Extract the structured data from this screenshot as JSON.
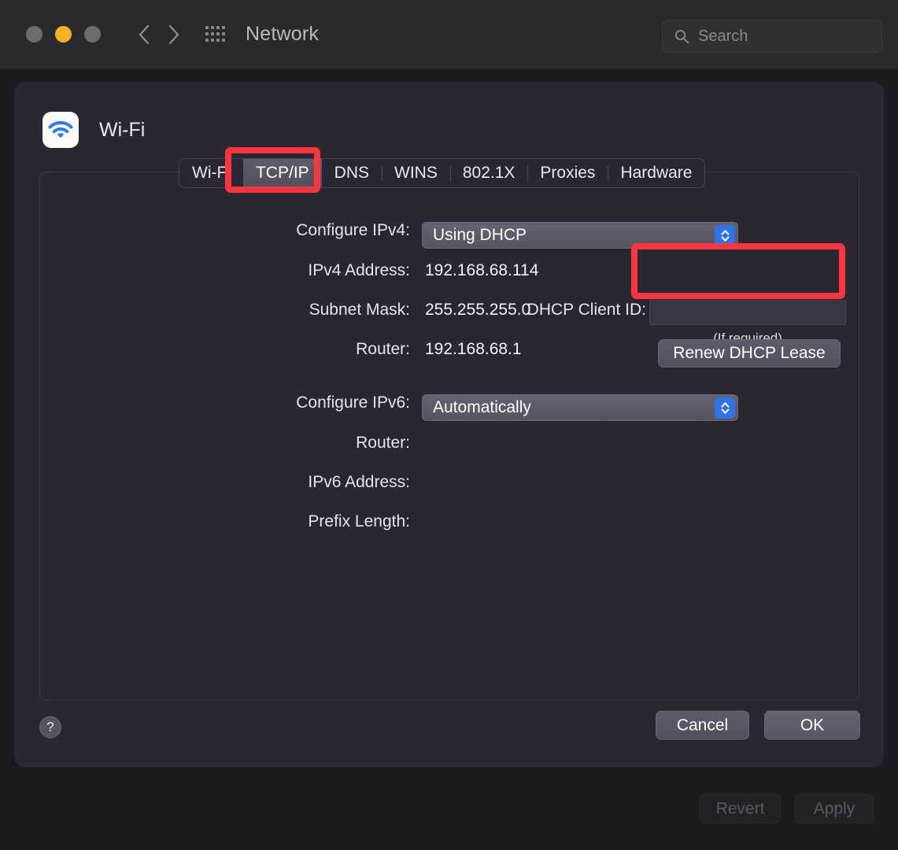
{
  "window": {
    "title": "Network",
    "traffic_lights": [
      "close",
      "minimize",
      "zoom"
    ],
    "back_icon": "chevron-left-icon",
    "forward_icon": "chevron-right-icon",
    "grid_icon": "grid-apps-icon",
    "search": {
      "placeholder": "Search",
      "value": "",
      "icon": "search-icon"
    }
  },
  "sheet": {
    "device": {
      "name": "Wi-Fi",
      "icon": "wifi-icon"
    },
    "tabs": [
      {
        "label": "Wi-Fi",
        "selected": false
      },
      {
        "label": "TCP/IP",
        "selected": true
      },
      {
        "label": "DNS",
        "selected": false
      },
      {
        "label": "WINS",
        "selected": false
      },
      {
        "label": "802.1X",
        "selected": false
      },
      {
        "label": "Proxies",
        "selected": false
      },
      {
        "label": "Hardware",
        "selected": false
      }
    ],
    "ipv4": {
      "configure_label": "Configure IPv4:",
      "configure_value": "Using DHCP",
      "address_label": "IPv4 Address:",
      "address_value": "192.168.68.114",
      "subnet_label": "Subnet Mask:",
      "subnet_value": "255.255.255.0",
      "router_label": "Router:",
      "router_value": "192.168.68.1"
    },
    "dhcp": {
      "renew_button": "Renew DHCP Lease",
      "client_id_label": "DHCP Client ID:",
      "client_id_value": "",
      "client_id_hint": "(If required)"
    },
    "ipv6": {
      "configure_label": "Configure IPv6:",
      "configure_value": "Automatically",
      "router_label": "Router:",
      "router_value": "",
      "address_label": "IPv6 Address:",
      "address_value": "",
      "prefix_label": "Prefix Length:",
      "prefix_value": ""
    },
    "footer": {
      "help_label": "?",
      "cancel_label": "Cancel",
      "ok_label": "OK"
    }
  },
  "background_controls": {
    "revert_label": "Revert",
    "apply_label": "Apply"
  },
  "annotations": {
    "accent_color": "#fb3640",
    "highlighted": [
      "TCP/IP",
      "Renew DHCP Lease"
    ]
  }
}
